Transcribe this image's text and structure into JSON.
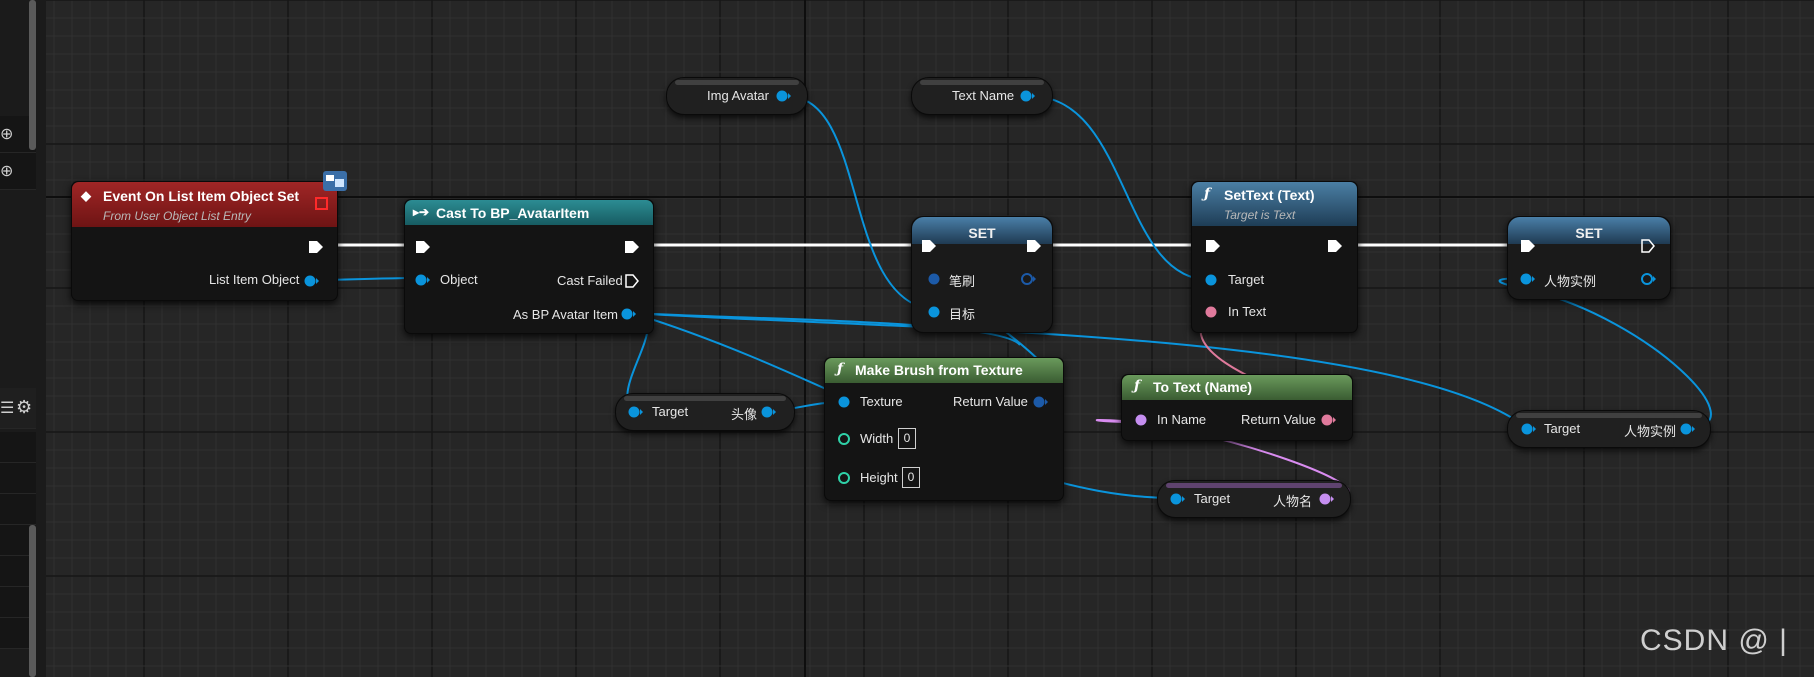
{
  "colors": {
    "canvas_bg": "#262626",
    "exec_wire": "#ffffff",
    "object_wire": "#0a94dc",
    "string_wire": "#d98cf0",
    "text_wire": "#e07a9c",
    "event_header": "#8b1c1c",
    "cast_header": "#1d6b72",
    "set_header": "#2a4e6e",
    "function_header": "#2f5c74",
    "pure_function_header": "#4d7a45"
  },
  "nodes": {
    "event": {
      "title": "Event On List Item Object Set",
      "subtitle": "From User Object List Entry",
      "icon": "event-diamond-icon",
      "badge": "interface-badge-icon",
      "pins": {
        "list_item_object": "List Item Object"
      }
    },
    "cast": {
      "title": "Cast To BP_AvatarItem",
      "icon": "cast-arrow-icon",
      "pins": {
        "object": "Object",
        "cast_failed": "Cast Failed",
        "as_item": "As BP Avatar Item"
      }
    },
    "img_avatar": {
      "label": "Img Avatar"
    },
    "text_name": {
      "label": "Text Name"
    },
    "set_brush": {
      "title": "SET",
      "pins": {
        "brush": "笔刷",
        "target": "目标"
      }
    },
    "set_text": {
      "title": "SetText (Text)",
      "subtitle": "Target is Text",
      "icon": "function-f-icon",
      "pins": {
        "target": "Target",
        "in_text": "In Text"
      }
    },
    "set_instance": {
      "title": "SET",
      "pins": {
        "instance": "人物实例"
      }
    },
    "get_avatar": {
      "target": "Target",
      "value": "头像"
    },
    "make_brush": {
      "title": "Make Brush from Texture",
      "icon": "function-f-icon",
      "pins": {
        "texture": "Texture",
        "return_value": "Return Value",
        "width": "Width",
        "width_value": "0",
        "height": "Height",
        "height_value": "0"
      }
    },
    "to_text": {
      "title": "To Text (Name)",
      "icon": "function-f-icon",
      "pins": {
        "in_name": "In Name",
        "return_value": "Return Value"
      }
    },
    "get_instance": {
      "target": "Target",
      "value": "人物实例"
    },
    "get_name": {
      "target": "Target",
      "value": "人物名"
    }
  },
  "left_panel": {
    "icons": [
      "add-circle-icon",
      "add-circle-icon",
      "list-icon",
      "gear-icon"
    ]
  },
  "watermark": "CSDN @ |"
}
